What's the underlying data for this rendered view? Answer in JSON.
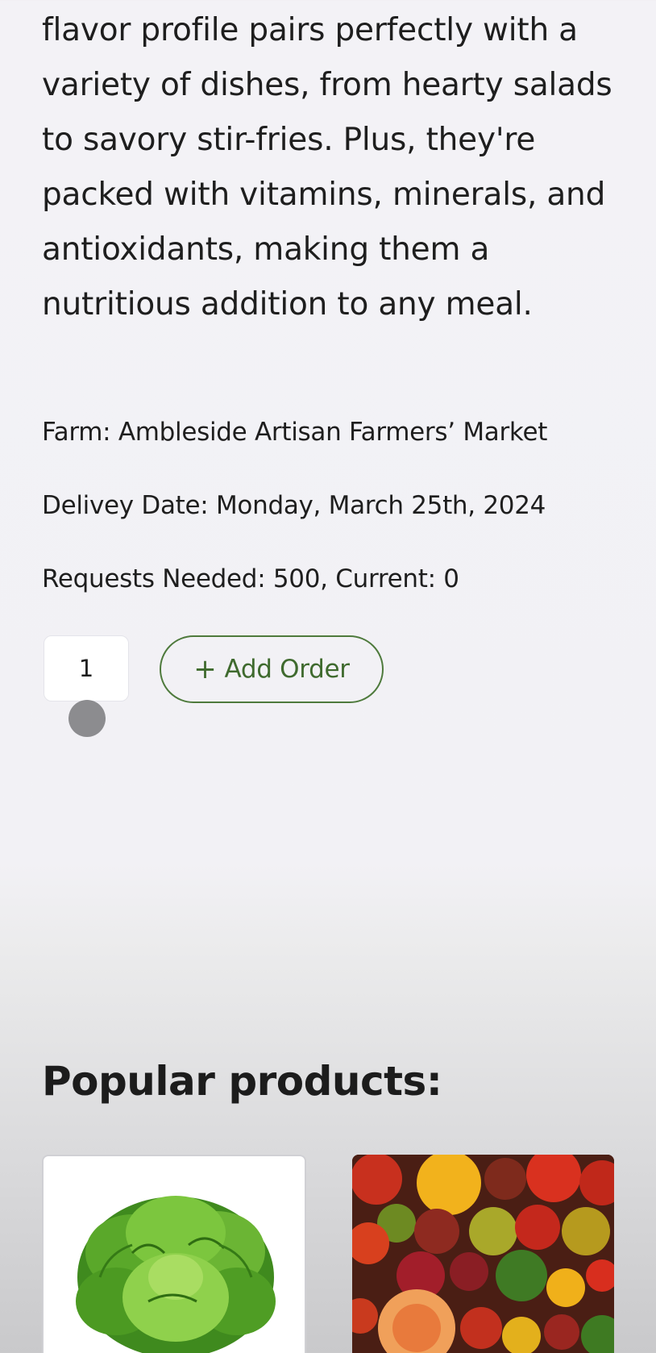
{
  "product": {
    "description": "flavor profile pairs perfectly with a variety of dishes, from hearty salads to savory stir-fries. Plus, they're packed with vitamins, minerals, and antioxidants, making them a nutritious addition to any meal.",
    "farm": "Farm: Ambleside Artisan Farmers’ Market",
    "delivery_date": "Delivey Date: Monday, March 25th, 2024",
    "requests": "Requests Needed: 500, Current: 0"
  },
  "order": {
    "quantity": "1",
    "add_button_label": "Add Order",
    "add_button_icon": "plus-icon",
    "accent_color": "#4e7a3c"
  },
  "popular": {
    "title": "Popular products:",
    "items": [
      {
        "icon": "lettuce-image"
      },
      {
        "icon": "tomatoes-image"
      }
    ]
  }
}
